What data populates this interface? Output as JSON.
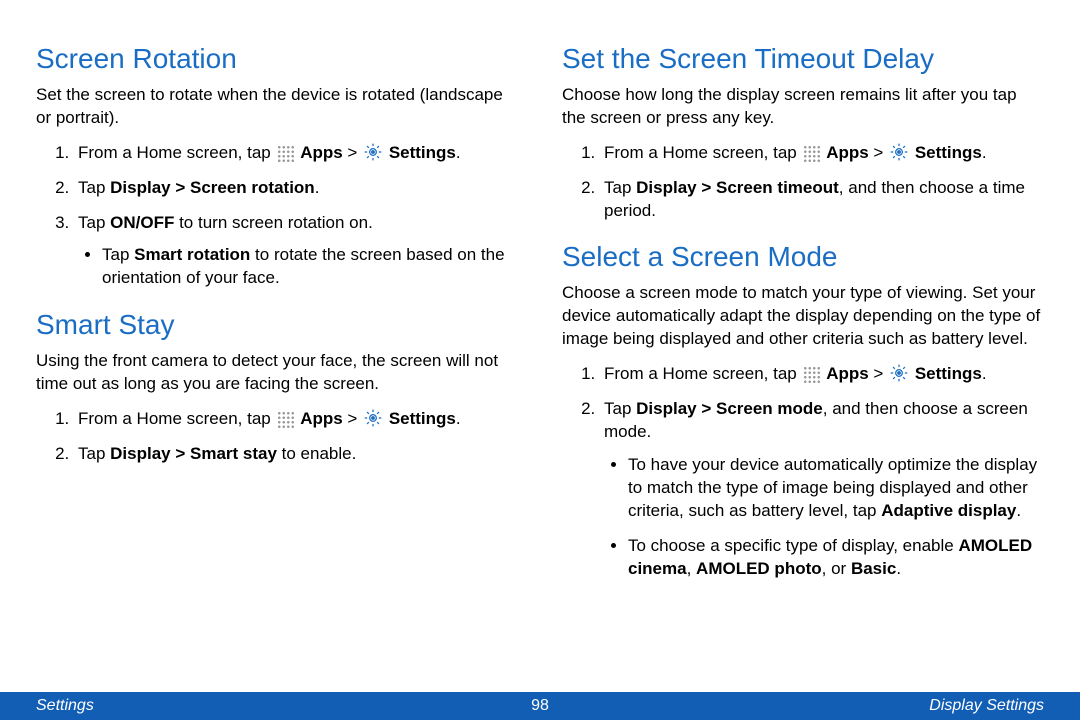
{
  "left": {
    "section1": {
      "heading": "Screen Rotation",
      "intro": "Set the screen to rotate when the device is rotated (landscape or portrait).",
      "step1_a": "From a Home screen, tap ",
      "step1_b_apps": "Apps",
      "step1_c": " > ",
      "step1_d_settings": "Settings",
      "step1_e": ".",
      "step2_a": "Tap ",
      "step2_b": "Display > Screen rotation",
      "step2_c": ".",
      "step3_a": "Tap ",
      "step3_b": "ON/OFF",
      "step3_c": " to turn screen rotation on.",
      "bullet_a": "Tap ",
      "bullet_b": "Smart rotation",
      "bullet_c": " to rotate the screen based on the orientation of your face."
    },
    "section2": {
      "heading": "Smart Stay",
      "intro": "Using the front camera to detect your face, the screen will not time out as long as you are facing the screen.",
      "step1_a": "From a Home screen, tap ",
      "step1_b_apps": "Apps",
      "step1_c": " > ",
      "step1_d_settings": "Settings",
      "step1_e": ".",
      "step2_a": "Tap ",
      "step2_b": "Display > Smart stay",
      "step2_c": " to enable."
    }
  },
  "right": {
    "section1": {
      "heading": "Set the Screen Timeout Delay",
      "intro": "Choose how long the display screen remains lit after you tap the screen or press any key.",
      "step1_a": "From a Home screen, tap ",
      "step1_b_apps": "Apps",
      "step1_c": " > ",
      "step1_d_settings": "Settings",
      "step1_e": ".",
      "step2_a": "Tap ",
      "step2_b": "Display > Screen timeout",
      "step2_c": ", and then choose a time period."
    },
    "section2": {
      "heading": "Select a Screen Mode",
      "intro": "Choose a screen mode to match your type of viewing. Set your device automatically adapt the display depending on the type of image being displayed and other criteria such as battery level.",
      "step1_a": "From a Home screen, tap ",
      "step1_b_apps": "Apps",
      "step1_c": " > ",
      "step1_d_settings": "Settings",
      "step1_e": ".",
      "step2_a": "Tap ",
      "step2_b": "Display > Screen mode",
      "step2_c": ", and then choose a screen mode.",
      "bullet1_a": "To have your device automatically optimize the display to match the type of image being displayed and other criteria, such as battery level, tap ",
      "bullet1_b": "Adaptive display",
      "bullet1_c": ".",
      "bullet2_a": "To choose a specific type of display, enable ",
      "bullet2_b": "AMOLED cinema",
      "bullet2_c": ", ",
      "bullet2_d": "AMOLED photo",
      "bullet2_e": ", or ",
      "bullet2_f": "Basic",
      "bullet2_g": "."
    }
  },
  "footer": {
    "left": "Settings",
    "center": "98",
    "right": "Display Settings"
  }
}
